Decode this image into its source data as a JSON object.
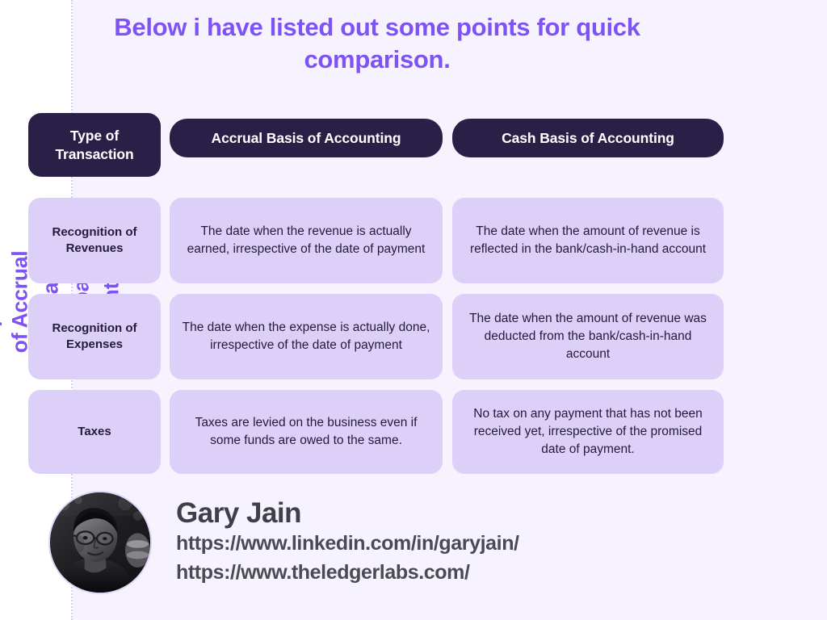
{
  "slide": {
    "background_color": "#f6f2fe",
    "accent_color": "#7f52f5",
    "header_cell_color": "#2a1f47",
    "body_cell_color": "#ddd0f8",
    "side_title": "A Comparison of Accrual vs. Cash-\nbasis Accounting",
    "deck_title": "Below i have listed out some points for quick comparison."
  },
  "table": {
    "headers": [
      "Type of Transaction",
      "Accrual Basis of Accounting",
      "Cash Basis of Accounting"
    ],
    "rows": [
      {
        "label": "Recognition of Revenues",
        "accrual": "The date when the revenue is actually earned, irrespective of the date of payment",
        "cash": "The date when the amount of revenue is reflected in the bank/cash-in-hand account"
      },
      {
        "label": "Recognition of Expenses",
        "accrual": "The date when the expense is actually done, irrespective of the date of payment",
        "cash": "The date when the amount of revenue was deducted from the bank/cash-in-hand account"
      },
      {
        "label": "Taxes",
        "accrual": "Taxes are levied on the business even if some funds are owed to the same.",
        "cash": "No tax on any payment that has not been received yet, irrespective of the promised date of payment."
      }
    ]
  },
  "footer": {
    "avatar_alt": "portrait-photo",
    "name": "Gary Jain",
    "link_linkedin": "https://www.linkedin.com/in/garyjain/",
    "link_website": "https://www.theledgerlabs.com/"
  }
}
